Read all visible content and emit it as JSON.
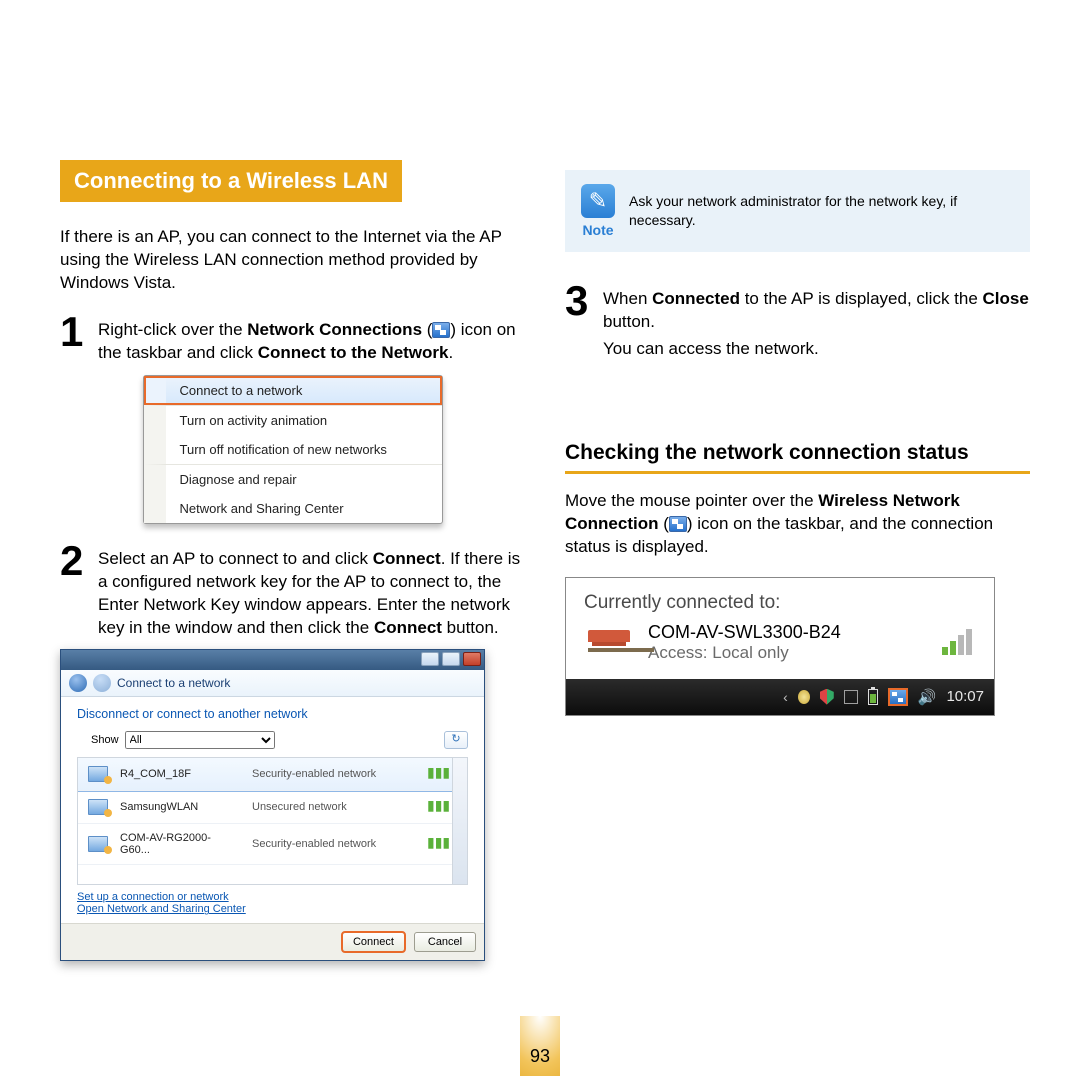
{
  "section_title": "Connecting to a Wireless LAN",
  "intro": "If there is an AP, you can connect to the Internet via the AP using the Wireless LAN connection method provided by Windows Vista.",
  "step1": {
    "a": "Right-click over the ",
    "b": "Network Connections",
    "c": " (",
    "d": ") icon on the taskbar and click ",
    "e": "Connect to the Network",
    "f": "."
  },
  "context_menu": {
    "items": [
      "Connect to a network",
      "Turn on activity animation",
      "Turn off notification of new networks",
      "Diagnose and repair",
      "Network and Sharing Center"
    ]
  },
  "step2": {
    "a": "Select an AP to connect to and click ",
    "b": "Connect",
    "c": ". If there is a configured network key for the AP to connect to, the Enter Network Key window appears. Enter the network key in the window and then click the ",
    "d": "Connect",
    "e": " button."
  },
  "dialog": {
    "title": "Connect to a network",
    "subtitle": "Disconnect or connect to another network",
    "show_label": "Show",
    "show_value": "All",
    "networks": [
      {
        "name": "R4_COM_18F",
        "sec": "Security-enabled network"
      },
      {
        "name": "SamsungWLAN",
        "sec": "Unsecured network"
      },
      {
        "name": "COM-AV-RG2000-G60...",
        "sec": "Security-enabled network"
      }
    ],
    "link1": "Set up a connection or network",
    "link2": "Open Network and Sharing Center",
    "connect_btn": "Connect",
    "cancel_btn": "Cancel"
  },
  "note": {
    "label": "Note",
    "text": "Ask your network administrator for the network key, if necessary."
  },
  "step3": {
    "a": "When ",
    "b": "Connected",
    "c": " to the AP is displayed, click the ",
    "d": "Close",
    "e": " button.",
    "f": "You can access the network."
  },
  "subsection_title": "Checking the network connection status",
  "sub_body": {
    "a": "Move the mouse pointer over the ",
    "b": "Wireless Network Connection",
    "c": " (",
    "d": ") icon on the taskbar, and the connection status is displayed."
  },
  "status_tooltip": {
    "header": "Currently connected to:",
    "ssid": "COM-AV-SWL3300-B24",
    "access": "Access:  Local only",
    "clock": "10:07"
  },
  "page_number": "93"
}
